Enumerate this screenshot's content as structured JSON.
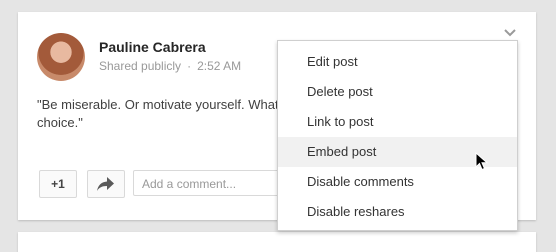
{
  "post": {
    "author": "Pauline Cabrera",
    "visibility": "Shared publicly",
    "separator": "·",
    "time": "2:52 AM",
    "text": "\"Be miserable. Or motivate yourself. Whate\nchoice.\""
  },
  "actions": {
    "plus_one": "+1",
    "comment_placeholder": "Add a comment..."
  },
  "menu": {
    "items": [
      "Edit post",
      "Delete post",
      "Link to post",
      "Embed post",
      "Disable comments",
      "Disable reshares"
    ],
    "hovered_index": 3
  },
  "icons": {
    "chevron": "chevron-down-icon",
    "share": "share-arrow-icon",
    "cursor": "mouse-pointer-icon"
  }
}
